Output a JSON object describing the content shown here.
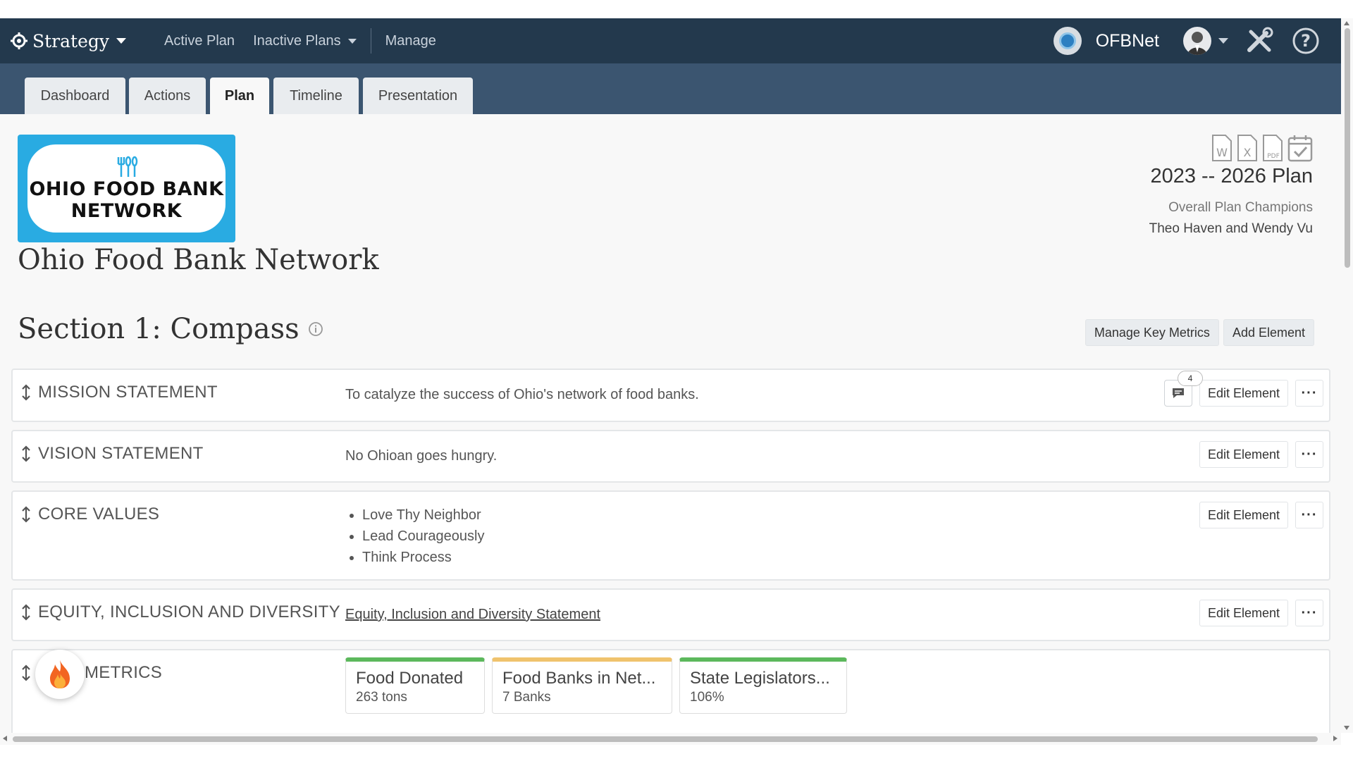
{
  "topbar": {
    "brand": "Strategy",
    "nav": {
      "active_plan": "Active Plan",
      "inactive_plans": "Inactive Plans",
      "manage": "Manage"
    },
    "org_name": "OFBNet"
  },
  "tabs": [
    "Dashboard",
    "Actions",
    "Plan",
    "Timeline",
    "Presentation"
  ],
  "active_tab": "Plan",
  "header": {
    "logo_text_line1": "OHIO FOOD BANK",
    "logo_text_line2": "NETWORK",
    "org_title": "Ohio Food Bank Network",
    "plan_title": "2023 -- 2026 Plan",
    "champions_label": "Overall Plan Champions",
    "champions_names": "Theo Haven and Wendy Vu"
  },
  "section": {
    "title": "Section 1: Compass",
    "manage_key_metrics": "Manage Key Metrics",
    "add_element": "Add Element"
  },
  "elements": {
    "edit_label": "Edit Element",
    "more_label": "···",
    "mission": {
      "label": "MISSION STATEMENT",
      "value": "To catalyze the success of Ohio's network of food banks.",
      "comment_count": "4"
    },
    "vision": {
      "label": "VISION STATEMENT",
      "value": "No Ohioan goes hungry."
    },
    "core_values": {
      "label": "CORE VALUES",
      "items": [
        "Love Thy Neighbor",
        "Lead Courageously",
        "Think Process"
      ]
    },
    "equity": {
      "label": "EQUITY, INCLUSION AND DIVERSITY",
      "link": "Equity, Inclusion and Diversity Statement"
    },
    "metrics": {
      "label": "METRICS",
      "cards": [
        {
          "name": "Food Donated",
          "value": "263 tons",
          "color": "#5cb85c"
        },
        {
          "name": "Food Banks in Net...",
          "value": "7 Banks",
          "color": "#f0c36d"
        },
        {
          "name": "State Legislators...",
          "value": "106%",
          "color": "#5cb85c"
        }
      ]
    }
  },
  "colors": {
    "topbar": "#23394d",
    "tabbar": "#3b5570",
    "logo_blue": "#29abe2"
  }
}
